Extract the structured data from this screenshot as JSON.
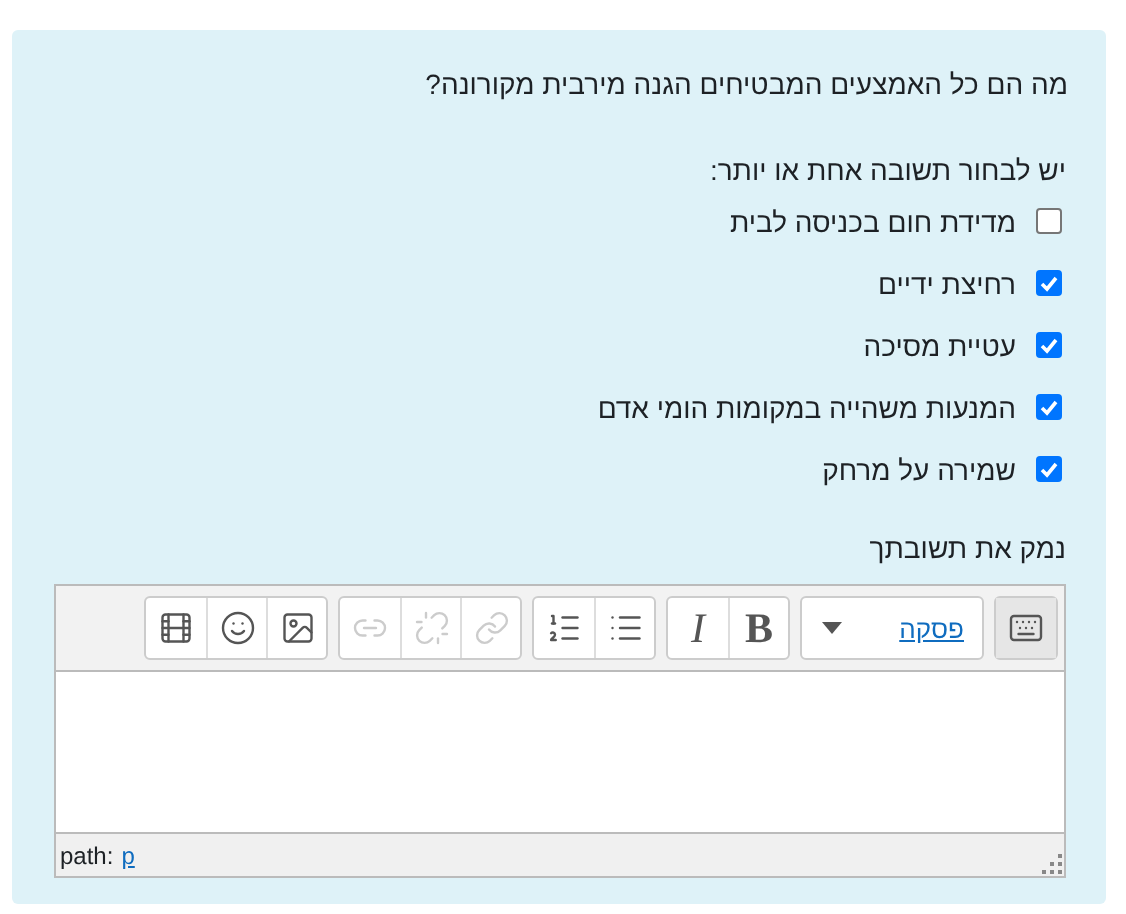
{
  "question": "מה הם כל האמצעים המבטיחים הגנה מירבית מקורונה?",
  "instruction": "יש לבחור תשובה אחת או יותר:",
  "options": [
    {
      "label": "מדידת חום בכניסה לבית",
      "checked": false
    },
    {
      "label": "רחיצת ידיים",
      "checked": true
    },
    {
      "label": "עטיית מסיכה",
      "checked": true
    },
    {
      "label": "המנעות משהייה במקומות הומי אדם",
      "checked": true
    },
    {
      "label": "שמירה על מרחק",
      "checked": true
    }
  ],
  "explanation_label": "נמק את תשובתך",
  "editor": {
    "toolbar": [
      [
        {
          "kind": "keyboard",
          "disabled": false
        }
      ],
      [
        {
          "kind": "format",
          "label": "פסקה"
        }
      ],
      [
        {
          "kind": "bold",
          "label": "B",
          "disabled": false
        },
        {
          "kind": "italic",
          "label": "I",
          "disabled": false
        }
      ],
      [
        {
          "kind": "bullets",
          "disabled": false
        },
        {
          "kind": "numbered",
          "disabled": false
        }
      ],
      [
        {
          "kind": "link",
          "disabled": true
        },
        {
          "kind": "unlink",
          "disabled": true
        },
        {
          "kind": "anchor",
          "disabled": true
        }
      ],
      [
        {
          "kind": "image",
          "disabled": false
        },
        {
          "kind": "emoji",
          "disabled": false
        },
        {
          "kind": "media",
          "disabled": false
        }
      ]
    ],
    "path_label": "path:",
    "path_value": "p"
  }
}
